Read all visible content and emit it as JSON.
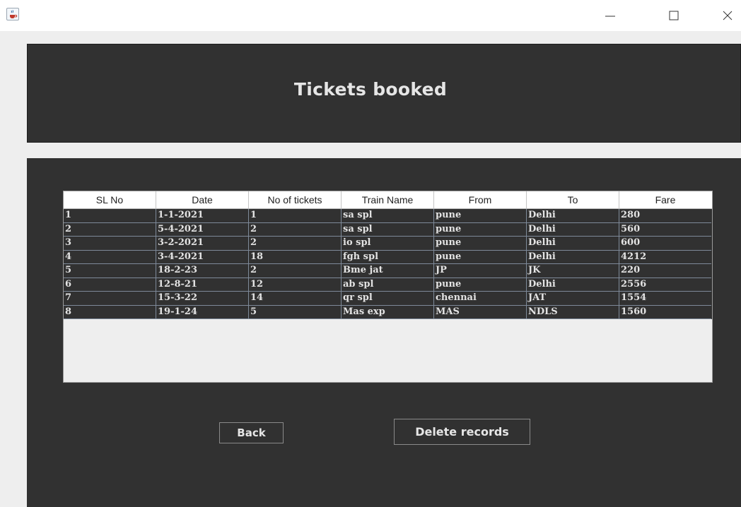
{
  "window": {
    "minimize_glyph": "—",
    "maximize_glyph": "☐",
    "close_glyph": "✕"
  },
  "header": {
    "title": "Tickets booked"
  },
  "table": {
    "columns": [
      "SL No",
      "Date",
      "No of tickets",
      "Train Name",
      "From",
      "To",
      "Fare"
    ],
    "rows": [
      [
        "1",
        "1-1-2021",
        "1",
        "sa spl",
        "pune",
        "Delhi",
        "280"
      ],
      [
        "2",
        "5-4-2021",
        "2",
        "sa spl",
        "pune",
        "Delhi",
        "560"
      ],
      [
        "3",
        "3-2-2021",
        "2",
        "io spl",
        "pune",
        "Delhi",
        "600"
      ],
      [
        "4",
        "3-4-2021",
        "18",
        "fgh spl",
        "pune",
        "Delhi",
        "4212"
      ],
      [
        "5",
        "18-2-23",
        "2",
        "Bme jat",
        "JP",
        "JK",
        "220"
      ],
      [
        "6",
        "12-8-21",
        "12",
        "ab spl",
        "pune",
        "Delhi",
        "2556"
      ],
      [
        "7",
        "15-3-22",
        "14",
        "qr spl",
        "chennai",
        "JAT",
        "1554"
      ],
      [
        "8",
        "19-1-24",
        "5",
        "Mas exp",
        "MAS",
        "NDLS",
        "1560"
      ]
    ]
  },
  "buttons": {
    "back_label": "Back",
    "delete_label": "Delete records"
  },
  "colors": {
    "panel_bg": "#313131",
    "window_bg": "#eeeeee",
    "text_light": "#e3e3e3",
    "grid_line": "#7e8a99"
  }
}
